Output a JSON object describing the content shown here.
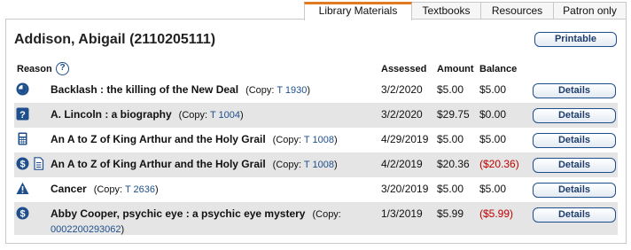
{
  "tabs": [
    {
      "label": "Library Materials",
      "active": true
    },
    {
      "label": "Textbooks",
      "active": false
    },
    {
      "label": "Resources",
      "active": false
    },
    {
      "label": "Patron only",
      "active": false
    }
  ],
  "patron": {
    "name": "Addison, Abigail (2110205111)"
  },
  "printable_label": "Printable",
  "headers": {
    "reason": "Reason",
    "assessed": "Assessed",
    "amount": "Amount",
    "balance": "Balance"
  },
  "help_icon": "?",
  "colors": {
    "accent": "#e07b1f",
    "link": "#1e4f8c",
    "negative": "#c00000",
    "icon": "#1e4f8c"
  },
  "rows": [
    {
      "title": "Backlash : the killing of the New Deal",
      "copy_prefix": "(Copy: ",
      "copy_id": "T 1930",
      "copy_suffix": ")",
      "assessed": "3/2/2020",
      "amount": "$5.00",
      "balance": "$5.00",
      "details": "Details",
      "icons": [
        "overdue-icon"
      ]
    },
    {
      "title": "A. Lincoln : a biography",
      "copy_prefix": "(Copy: ",
      "copy_id": "T 1004",
      "copy_suffix": ")",
      "assessed": "3/2/2020",
      "amount": "$29.75",
      "balance": "$0.00",
      "details": "Details",
      "icons": [
        "lost-icon"
      ]
    },
    {
      "title": "An A to Z of King Arthur and the Holy Grail",
      "copy_prefix": "(Copy: ",
      "copy_id": "T 1008",
      "copy_suffix": ")",
      "assessed": "4/29/2019",
      "amount": "$5.00",
      "balance": "$5.00",
      "details": "Details",
      "icons": [
        "calculator-icon"
      ]
    },
    {
      "title": "An A to Z of King Arthur and the Holy Grail",
      "copy_prefix": "(Copy: ",
      "copy_id": "T 1008",
      "copy_suffix": ")",
      "assessed": "4/2/2019",
      "amount": "$20.36",
      "balance": "($20.36)",
      "details": "Details",
      "icons": [
        "dollar-icon",
        "document-icon"
      ]
    },
    {
      "title": "Cancer",
      "copy_prefix": "(Copy: ",
      "copy_id": "T 2636",
      "copy_suffix": ")",
      "assessed": "3/20/2019",
      "amount": "$5.00",
      "balance": "$5.00",
      "details": "Details",
      "icons": [
        "warning-icon"
      ]
    },
    {
      "title": "Abby Cooper, psychic eye : a psychic eye mystery",
      "copy_prefix": "(Copy: ",
      "copy_id": "0002200293062",
      "copy_suffix": ")",
      "assessed": "1/3/2019",
      "amount": "$5.99",
      "balance": "($5.99)",
      "details": "Details",
      "icons": [
        "dollar-icon"
      ]
    }
  ]
}
